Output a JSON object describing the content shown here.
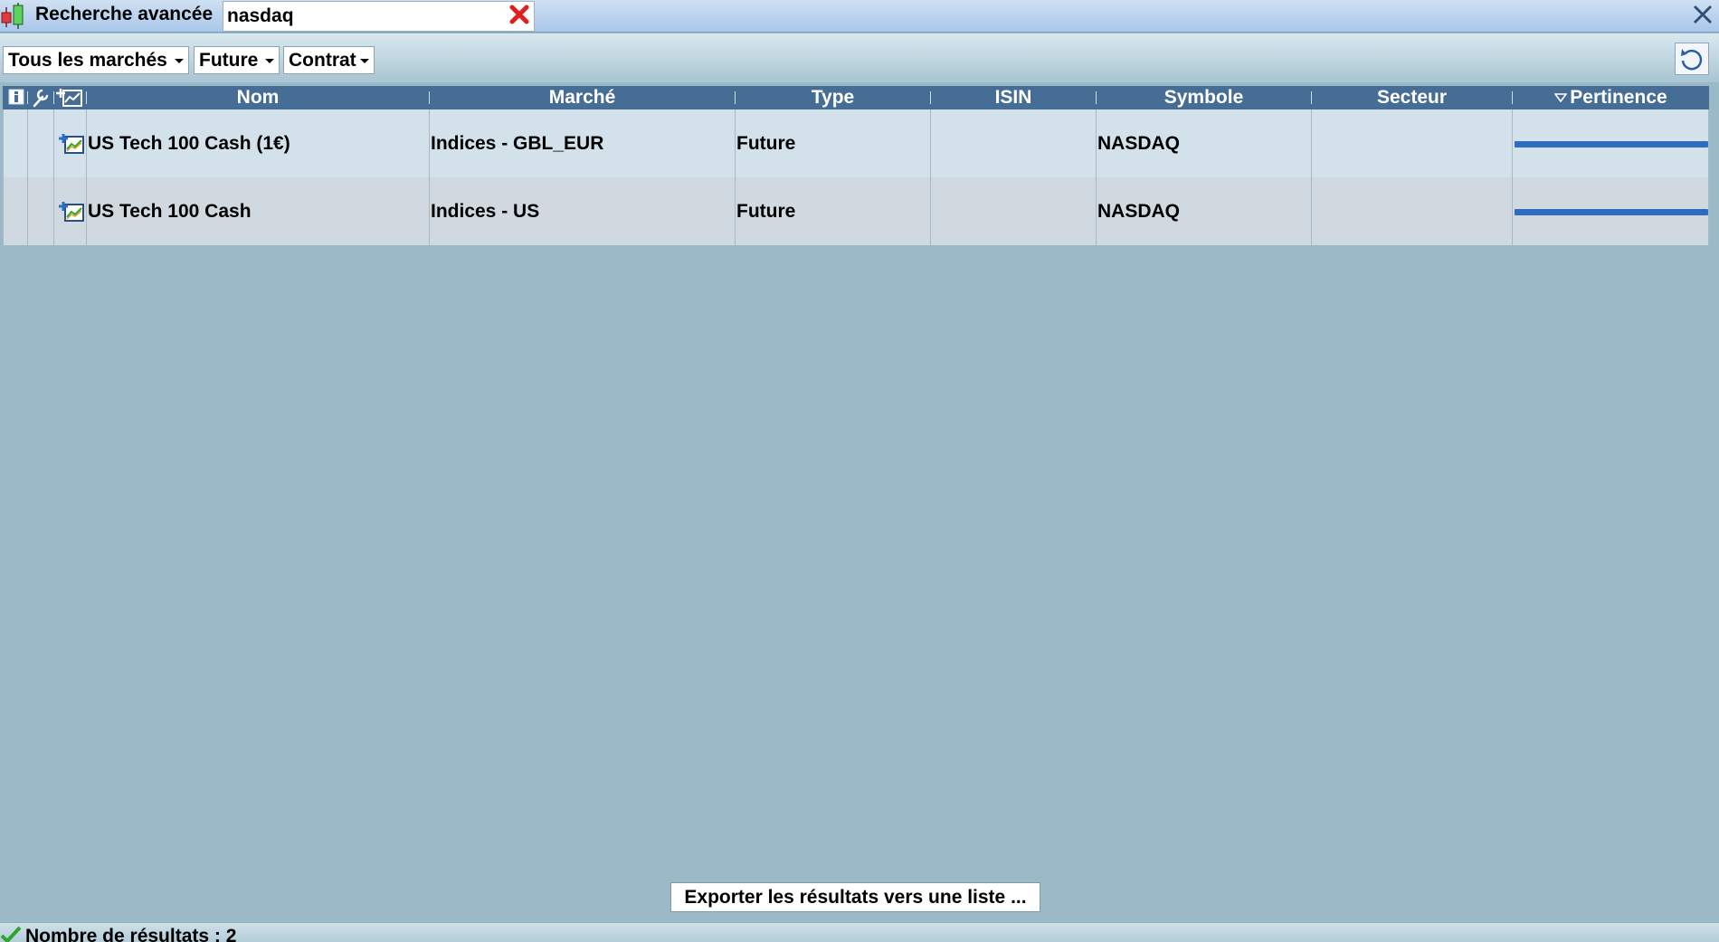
{
  "window": {
    "title": "Recherche avancée",
    "search_value": "nasdaq",
    "search_placeholder": ""
  },
  "filters": {
    "markets": "Tous les marchés",
    "type": "Future",
    "contract": "Contrat"
  },
  "table": {
    "columns": {
      "name": "Nom",
      "market": "Marché",
      "type": "Type",
      "isin": "ISIN",
      "symbol": "Symbole",
      "sector": "Secteur",
      "relevance": "Pertinence"
    },
    "sort_column": "relevance",
    "rows": [
      {
        "name": "US Tech 100 Cash (1€)",
        "market": "Indices - GBL_EUR",
        "type": "Future",
        "isin": "",
        "symbol": "NASDAQ",
        "sector": "",
        "relevance": 1.0
      },
      {
        "name": "US Tech 100 Cash",
        "market": "Indices - US",
        "type": "Future",
        "isin": "",
        "symbol": "NASDAQ",
        "sector": "",
        "relevance": 1.0
      }
    ]
  },
  "footer": {
    "export_label": "Exporter les résultats vers une liste ...",
    "status_text": "Nombre de résultats : 2"
  },
  "colors": {
    "header_bg": "#466d96",
    "relevance_bar": "#2f6bc1",
    "background": "#9bbac7"
  }
}
